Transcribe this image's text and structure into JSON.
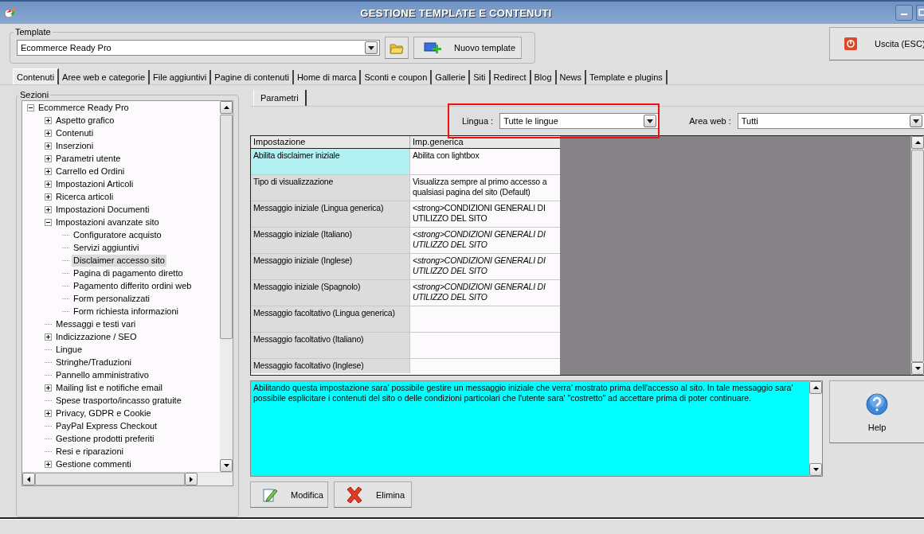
{
  "window": {
    "title": "GESTIONE TEMPLATE E CONTENUTI"
  },
  "template": {
    "label": "Template",
    "value": "Ecommerce Ready Pro",
    "new_button": "Nuovo template"
  },
  "exit_button": "Uscita (ESC)",
  "tabs": [
    {
      "label": "Contenuti",
      "selected": true
    },
    {
      "label": "Aree web e categorie",
      "selected": false
    },
    {
      "label": "File aggiuntivi",
      "selected": false
    },
    {
      "label": "Pagine di contenuti",
      "selected": false
    },
    {
      "label": "Home di marca",
      "selected": false
    },
    {
      "label": "Sconti e coupon",
      "selected": false
    },
    {
      "label": "Gallerie",
      "selected": false
    },
    {
      "label": "Siti",
      "selected": false
    },
    {
      "label": "Redirect",
      "selected": false
    },
    {
      "label": "Blog",
      "selected": false
    },
    {
      "label": "News",
      "selected": false
    },
    {
      "label": "Template e plugins",
      "selected": false
    }
  ],
  "sections": {
    "label": "Sezioni",
    "tree": [
      {
        "label": "Ecommerce Ready Pro",
        "expanded": true,
        "selected": false,
        "children": [
          {
            "label": "Aspetto grafico",
            "expanded": false,
            "selected": false
          },
          {
            "label": "Contenuti",
            "expanded": false,
            "selected": false
          },
          {
            "label": "Inserzioni",
            "expanded": false,
            "selected": false
          },
          {
            "label": "Parametri utente",
            "expanded": false,
            "selected": false
          },
          {
            "label": "Carrello ed Ordini",
            "expanded": false,
            "selected": false
          },
          {
            "label": "Impostazioni Articoli",
            "expanded": false,
            "selected": false
          },
          {
            "label": "Ricerca articoli",
            "expanded": false,
            "selected": false
          },
          {
            "label": "Impostazioni Documenti",
            "expanded": false,
            "selected": false
          },
          {
            "label": "Impostazioni avanzate sito",
            "expanded": true,
            "selected": false,
            "children": [
              {
                "label": "Configuratore acquisto",
                "selected": false
              },
              {
                "label": "Servizi aggiuntivi",
                "selected": false
              },
              {
                "label": "Disclaimer accesso sito",
                "selected": true
              },
              {
                "label": "Pagina di pagamento diretto",
                "selected": false
              },
              {
                "label": "Pagamento differito ordini web",
                "selected": false
              },
              {
                "label": "Form personalizzati",
                "selected": false
              },
              {
                "label": "Form richiesta informazioni",
                "selected": false
              }
            ]
          },
          {
            "label": "Messaggi e testi vari",
            "selected": false
          },
          {
            "label": "Indicizzazione / SEO",
            "expanded": false,
            "selected": false
          },
          {
            "label": "Lingue",
            "selected": false
          },
          {
            "label": "Stringhe/Traduzioni",
            "selected": false
          },
          {
            "label": "Pannello amministrativo",
            "selected": false
          },
          {
            "label": "Mailing list e notifiche email",
            "expanded": false,
            "selected": false
          },
          {
            "label": "Spese trasporto/incasso gratuite",
            "selected": false
          },
          {
            "label": "Privacy, GDPR e Cookie",
            "expanded": false,
            "selected": false
          },
          {
            "label": "PayPal Express Checkout",
            "selected": false
          },
          {
            "label": "Gestione prodotti preferiti",
            "selected": false
          },
          {
            "label": "Resi e riparazioni",
            "selected": false
          },
          {
            "label": "Gestione commenti",
            "expanded": false,
            "selected": false
          }
        ]
      }
    ]
  },
  "params_tab": "Parametri",
  "language": {
    "label": "Lingua :",
    "value": "Tutte le lingue"
  },
  "web_area": {
    "label": "Area web :",
    "value": "Tutti"
  },
  "table": {
    "columns": [
      "Impostazione",
      "Imp.generica"
    ],
    "rows": [
      {
        "name": "Abilita disclaimer iniziale",
        "value": "Abilita con lightbox",
        "inherited": false,
        "selected": true
      },
      {
        "name": "Tipo di visualizzazione",
        "value": "Visualizza sempre al primo accesso a qualsiasi pagina del sito (Default)",
        "inherited": false,
        "selected": false
      },
      {
        "name": "Messaggio iniziale (Lingua generica)",
        "value": "<strong>CONDIZIONI GENERALI DI UTILIZZO DEL SITO",
        "inherited": false,
        "selected": false
      },
      {
        "name": "Messaggio iniziale (Italiano)",
        "value": "<strong>CONDIZIONI GENERALI DI UTILIZZO DEL SITO",
        "inherited": true,
        "selected": false
      },
      {
        "name": "Messaggio iniziale (Inglese)",
        "value": "<strong>CONDIZIONI GENERALI DI UTILIZZO DEL SITO",
        "inherited": true,
        "selected": false
      },
      {
        "name": "Messaggio iniziale (Spagnolo)",
        "value": "<strong>CONDIZIONI GENERALI DI UTILIZZO DEL SITO",
        "inherited": true,
        "selected": false
      },
      {
        "name": "Messaggio facoltativo (Lingua generica)",
        "selected": false
      },
      {
        "name": "Messaggio facoltativo (Italiano)",
        "selected": false
      },
      {
        "name": "Messaggio facoltativo (Inglese)",
        "selected": false
      }
    ]
  },
  "description": "Abilitando questa impostazione sara' possibile gestire un messaggio iniziale che verra' mostrato prima dell'accesso al sito. In tale messaggio sara' possibile esplicitare i contenuti del sito o delle condizioni particolari che l'utente sara' \"costretto\" ad accettare prima di poter continuare.",
  "help_button": "Help",
  "edit_button": "Modifica",
  "delete_button": "Elimina"
}
